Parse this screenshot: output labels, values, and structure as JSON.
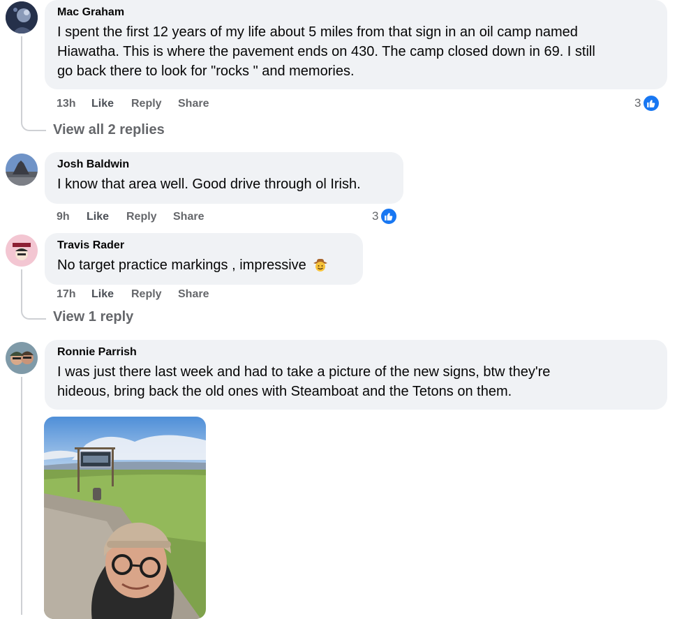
{
  "comments": [
    {
      "author": "Mac Graham",
      "lines": [
        "I spent the first 12 years of my life about 5 miles from that sign in an oil camp named",
        "Hiawatha. This is where the pavement ends on 430. The camp closed down in 69. I still",
        "go back there to look for \"rocks \" and memories."
      ],
      "time": "13h",
      "like_label": "Like",
      "reply_label": "Reply",
      "share_label": "Share",
      "reactions": "3",
      "view_replies": "View all 2 replies"
    },
    {
      "author": "Josh Baldwin",
      "lines": [
        "I know that area well. Good drive through ol Irish."
      ],
      "time": "9h",
      "like_label": "Like",
      "reply_label": "Reply",
      "share_label": "Share",
      "reactions": "3"
    },
    {
      "author": "Travis Rader",
      "lines": [
        "No target practice markings , impressive"
      ],
      "emoji": "cowboy-face-emoji",
      "time": "17h",
      "like_label": "Like",
      "reply_label": "Reply",
      "share_label": "Share",
      "view_replies": "View 1 reply"
    },
    {
      "author": "Ronnie Parrish",
      "lines": [
        "I was just there last week and had to take a picture of the new signs, btw they're",
        "hideous, bring back the old ones with Steamboat and the Tetons on them."
      ],
      "attachment": "photo-attachment"
    }
  ],
  "colors": {
    "bubble": "#f0f2f5",
    "secondary_text": "#65676b",
    "like_blue": "#1877f2",
    "thread_line": "#ced0d4"
  }
}
